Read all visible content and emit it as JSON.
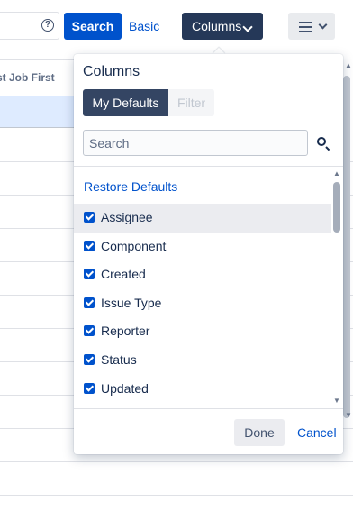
{
  "toolbar": {
    "search_label": "Search",
    "basic_label": "Basic",
    "columns_label": "Columns",
    "help_glyph": "?"
  },
  "table": {
    "column_header": "st Job First"
  },
  "columns_dropdown": {
    "title": "Columns",
    "tabs": [
      {
        "label": "My Defaults",
        "active": true
      },
      {
        "label": "Filter",
        "active": false
      }
    ],
    "search_placeholder": "Search",
    "restore_label": "Restore Defaults",
    "items": [
      {
        "label": "Assignee",
        "checked": true
      },
      {
        "label": "Component",
        "checked": true
      },
      {
        "label": "Created",
        "checked": true
      },
      {
        "label": "Issue Type",
        "checked": true
      },
      {
        "label": "Reporter",
        "checked": true
      },
      {
        "label": "Status",
        "checked": true
      },
      {
        "label": "Updated",
        "checked": true
      }
    ],
    "done_label": "Done",
    "cancel_label": "Cancel"
  },
  "colors": {
    "primary": "#0052cc",
    "dark_button": "#253858",
    "active_tab": "#344563",
    "selected_row": "#deebff"
  }
}
